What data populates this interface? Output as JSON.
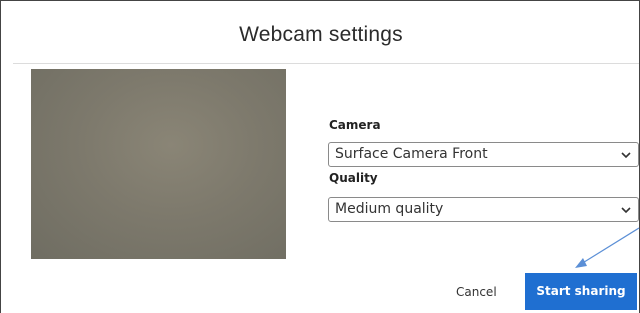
{
  "dialog": {
    "title": "Webcam settings"
  },
  "camera": {
    "label": "Camera",
    "selected": "Surface Camera Front"
  },
  "quality": {
    "label": "Quality",
    "selected": "Medium quality"
  },
  "actions": {
    "cancel_label": "Cancel",
    "start_label": "Start sharing"
  },
  "icons": {
    "dropdown": "chevron-down-icon",
    "annotation": "arrow-annotation"
  },
  "colors": {
    "primary_button": "#1f6fd1",
    "annotation_arrow": "#5b8fd6"
  }
}
